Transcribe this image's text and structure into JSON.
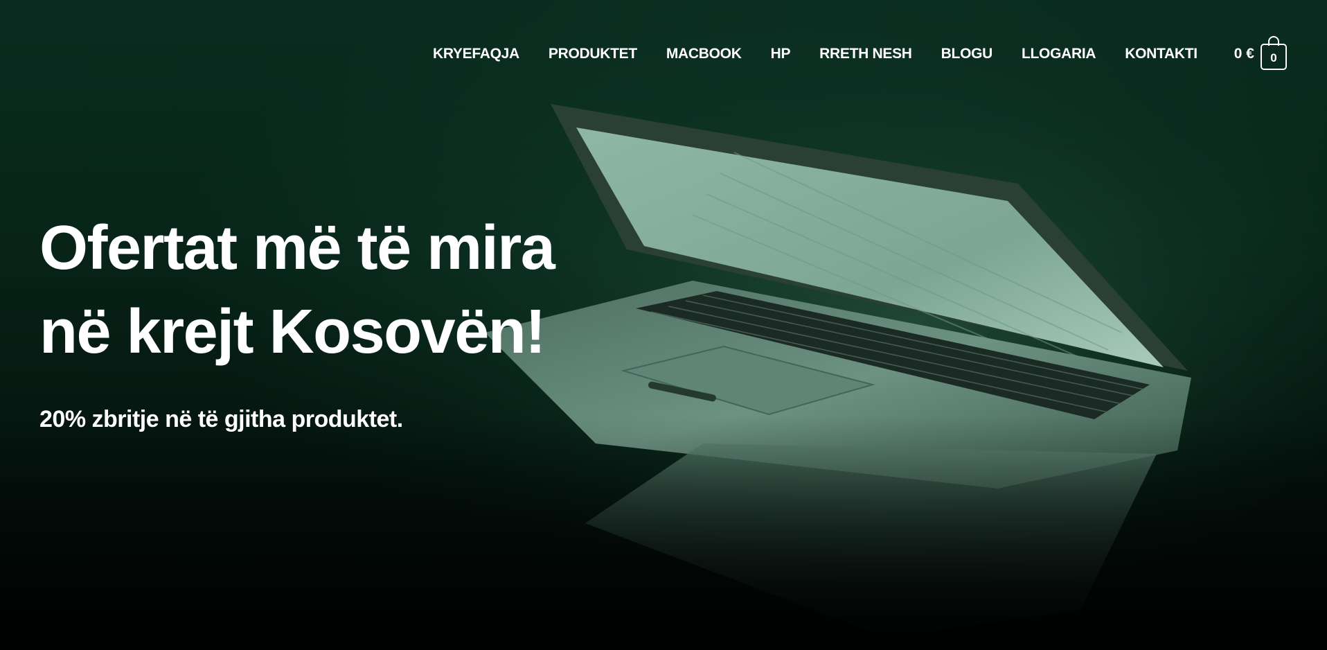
{
  "nav": {
    "items": [
      {
        "label": "KRYEFAQJA"
      },
      {
        "label": "PRODUKTET"
      },
      {
        "label": "MACBOOK"
      },
      {
        "label": "HP"
      },
      {
        "label": "RRETH NESH"
      },
      {
        "label": "BLOGU"
      },
      {
        "label": "LLOGARIA"
      },
      {
        "label": "KONTAKTI"
      }
    ]
  },
  "cart": {
    "total": "0 €",
    "count": "0",
    "icon": "shopping-bag-icon"
  },
  "hero": {
    "title_line1": "Ofertat më të mira",
    "title_line2": "në krejt Kosovën!",
    "subtitle": "20% zbritje në të gjitha produktet.",
    "image": "laptop-photo"
  },
  "colors": {
    "background_top": "#0a2c20",
    "background_bottom": "#020806",
    "text": "#ffffff"
  }
}
